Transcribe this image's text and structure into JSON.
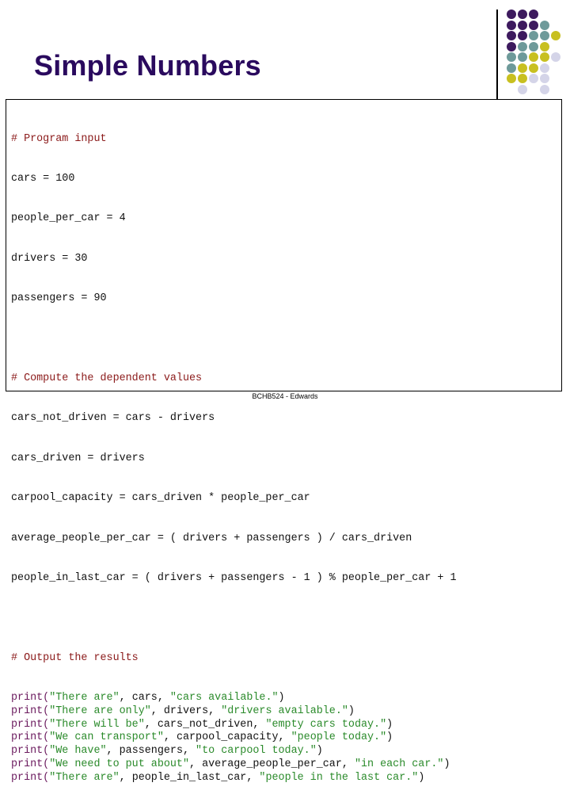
{
  "slide": {
    "title": "Simple Numbers",
    "footer": "BCHB524 - Edwards"
  },
  "decoration": {
    "dot_colors": {
      "purple": "#3d1a5e",
      "teal": "#6e9a9a",
      "yellow": "#c8c020",
      "lavender": "#d4d4e8"
    },
    "dot_grid": [
      [
        "purple",
        "purple",
        "purple",
        null,
        null
      ],
      [
        "purple",
        "purple",
        "purple",
        "teal",
        null
      ],
      [
        "purple",
        "purple",
        "teal",
        "teal",
        "yellow"
      ],
      [
        "purple",
        "teal",
        "teal",
        "yellow",
        null
      ],
      [
        "teal",
        "teal",
        "yellow",
        "yellow",
        "lavender"
      ],
      [
        "teal",
        "yellow",
        "yellow",
        "lavender",
        null
      ],
      [
        "yellow",
        "yellow",
        "lavender",
        "lavender",
        null
      ],
      [
        null,
        "lavender",
        null,
        "lavender",
        null
      ]
    ]
  },
  "code": {
    "sections": [
      {
        "comment": "# Program input",
        "lines": [
          "cars = 100",
          "people_per_car = 4",
          "drivers = 30",
          "passengers = 90"
        ]
      },
      {
        "comment": "# Compute the dependent values",
        "lines": [
          "cars_not_driven = cars - drivers",
          "cars_driven = drivers",
          "carpool_capacity = cars_driven * people_per_car",
          "average_people_per_car = ( drivers + passengers ) / cars_driven",
          "people_in_last_car = ( drivers + passengers - 1 ) % people_per_car + 1"
        ]
      },
      {
        "comment": "# Output the results",
        "prints": [
          {
            "s1": "\"There are\"",
            "var": "cars",
            "s2": "\"cars available.\""
          },
          {
            "s1": "\"There are only\"",
            "var": "drivers",
            "s2": "\"drivers available.\""
          },
          {
            "s1": "\"There will be\"",
            "var": "cars_not_driven",
            "s2": "\"empty cars today.\""
          },
          {
            "s1": "\"We can transport\"",
            "var": "carpool_capacity",
            "s2": "\"people today.\""
          },
          {
            "s1": "\"We have\"",
            "var": "passengers",
            "s2": "\"to carpool today.\""
          },
          {
            "s1": "\"We need to put about\"",
            "var": "average_people_per_car",
            "s2": "\"in each car.\""
          },
          {
            "s1": "\"There are\"",
            "var": "people_in_last_car",
            "s2": "\"people in the last car.\""
          }
        ],
        "print_keyword": "print"
      }
    ]
  }
}
